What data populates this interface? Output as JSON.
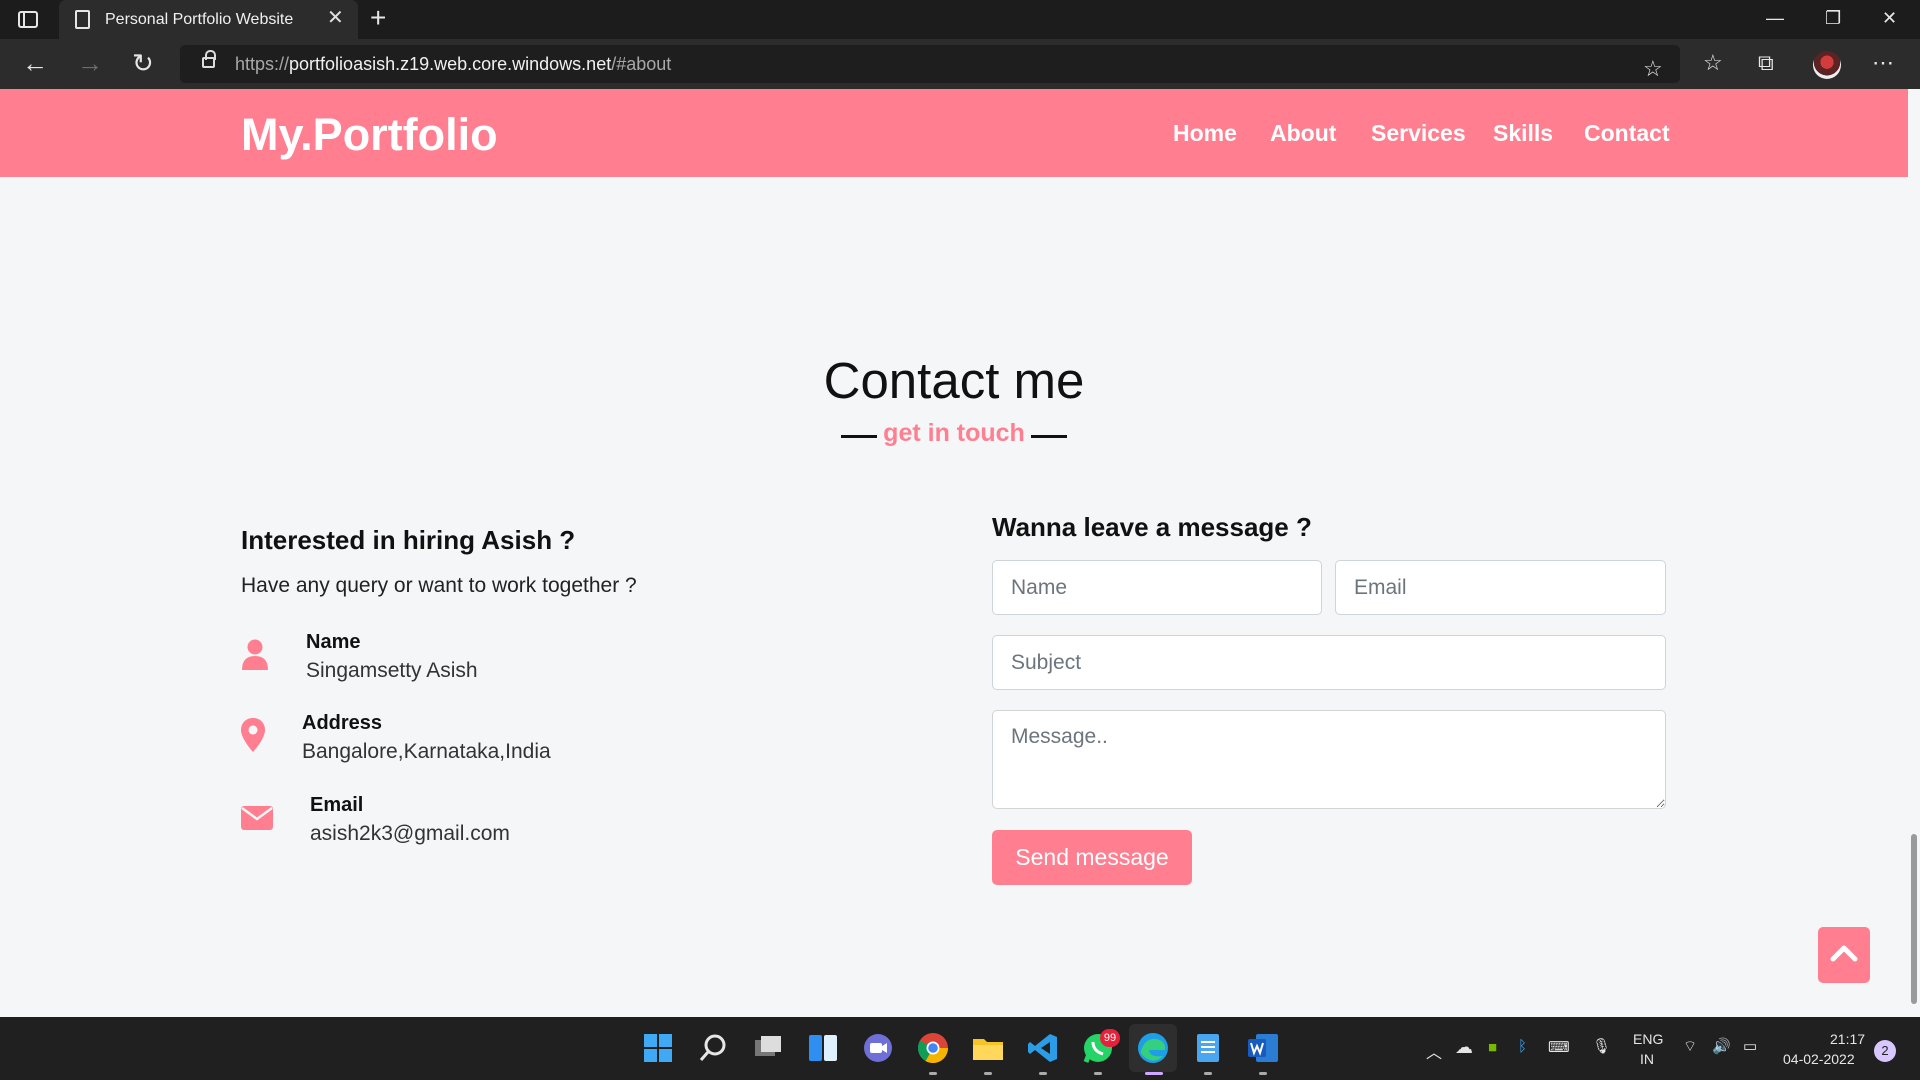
{
  "browser": {
    "tab_title": "Personal Portfolio Website",
    "url_prefix": "https://",
    "url_domain": "portfolioasish.z19.web.core.windows.net",
    "url_hash": "/#about"
  },
  "site": {
    "logo": "My.Portfolio",
    "nav": [
      "Home",
      "About",
      "Services",
      "Skills",
      "Contact"
    ]
  },
  "contact": {
    "title": "Contact me",
    "subtitle": "get in touch",
    "left_heading": "Interested in hiring Asish ?",
    "left_text": "Have any query or want to work together ?",
    "info": [
      {
        "label": "Name",
        "value": "Singamsetty Asish",
        "icon": "user-icon"
      },
      {
        "label": "Address",
        "value": "Bangalore,Karnataka,India",
        "icon": "map-marker-icon"
      },
      {
        "label": "Email",
        "value": "asish2k3@gmail.com",
        "icon": "envelope-icon"
      }
    ],
    "form_heading": "Wanna leave a message ?",
    "placeholders": {
      "name": "Name",
      "email": "Email",
      "subject": "Subject",
      "message": "Message.."
    },
    "send_label": "Send message"
  },
  "taskbar": {
    "lang": "ENG",
    "region": "IN",
    "time": "21:17",
    "date": "04-02-2022",
    "whatsapp_badge": "99",
    "notifications": "2"
  },
  "colors": {
    "accent": "#ff7f91",
    "page_bg": "#f4f6f7"
  }
}
